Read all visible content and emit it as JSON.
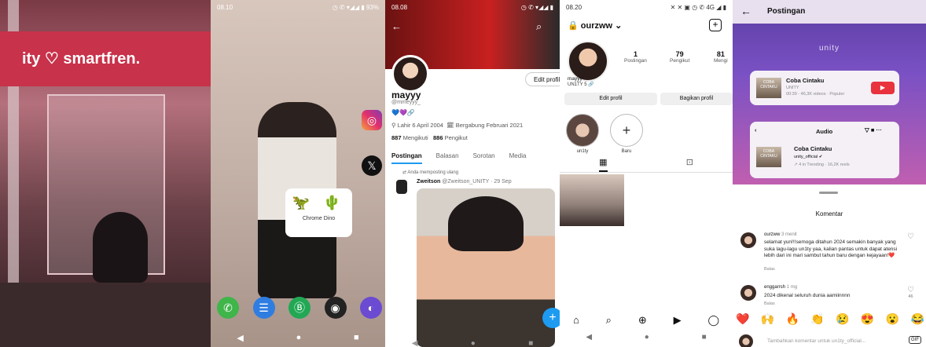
{
  "panel1": {
    "banner_text": "ity ♡ smartfren."
  },
  "panel2": {
    "status_time": "08.10",
    "status_icons": "◷ ✆ ▾◢◢ ▮ 93%",
    "app_dino_label": "Chrome Dino",
    "insta_glyph": "◎",
    "x_glyph": "𝕏",
    "dock_icons": [
      "✆",
      "☰",
      "Ⓑ",
      "◉",
      "◐"
    ],
    "nav": [
      "◀",
      "●",
      "■"
    ]
  },
  "panel3": {
    "status_time": "08.08",
    "status_icons": "◷ ✆ ▾◢◢ ▮",
    "back": "←",
    "search": "⌕",
    "edit_profile": "Edit profil",
    "name": "mayyy",
    "handle": "@mmeyyy_",
    "hearts": "💙💜🔗",
    "birth": "⚲ Lahir 6 April 2004",
    "joined": "🗓 Bergabung Februari 2021",
    "following_count": "887",
    "following_label": "Mengikuti",
    "followers_count": "886",
    "followers_label": "Pengikut",
    "tabs": [
      "Postingan",
      "Balasan",
      "Sorotan",
      "Media"
    ],
    "retweet": "⇄ Anda memposting ulang",
    "post_name": "Zweitson",
    "post_meta": "@Zweitson_UNITY · 29 Sep",
    "fab": "+",
    "nav": [
      "◀",
      "●",
      "■"
    ]
  },
  "panel4": {
    "status_time": "08.20",
    "status_icons": "✕ ✕ ▣  ◷ ✆ 4G ◢ ▮",
    "username": "🔒 ourzww ⌄",
    "plus": "+",
    "stats": [
      {
        "num": "1",
        "label": "Postingan"
      },
      {
        "num": "79",
        "label": "Pengikut"
      },
      {
        "num": "81",
        "label": "Mengi"
      }
    ],
    "display_name": "mayyy",
    "bio": "UN1TY 5 🔗",
    "edit_btn": "Edit profil",
    "share_btn": "Bagikan profil",
    "highlight_labels": [
      "un1ty",
      "Baru"
    ],
    "highlight_new": "+",
    "grid_icon": "▦",
    "tagged_icon": "⊡",
    "bottom_nav": [
      "⌂",
      "⌕",
      "⊕",
      "▶",
      "◯"
    ],
    "sys_nav": [
      "◀",
      "●",
      "■"
    ]
  },
  "panel5": {
    "back": "←",
    "title": "Postingan",
    "brand": "unity",
    "sound1_title": "Coba Cintaku",
    "sound1_artist": "UNITY",
    "sound1_meta": "00:39 · 46,3K videos · Populer",
    "cover_text": "COBA CINTAKU",
    "rec_glyph": "▶",
    "audio_label": "Audio",
    "audio_icons": "▽ ■ ···",
    "audio_back": "‹",
    "sound2_title": "Coba Cintaku",
    "sound2_artist": "unity_official ✔",
    "sound2_trend": "↗ 4 in Trending · 16,2K reels",
    "sheet_title": "Komentar",
    "comments": [
      {
        "user": "ourzww",
        "time": "3 menit",
        "text": "selamat yun!!!semoga ditahun 2024 semakin banyak yang suka lagu-lagu un1ty yaa, kalian pantas untuk dapat atensi lebih dari ini mari sambut tahun baru dengan kejayaan!❤️",
        "reply": "Balas",
        "likes": ""
      },
      {
        "user": "enggarrsh",
        "time": "1 mg",
        "text": "2024 dikenal seluruh dunia aamiinnnn",
        "reply": "Balas",
        "likes": "46"
      }
    ],
    "heart": "♡",
    "emojis": [
      "❤️",
      "🙌",
      "🔥",
      "👏",
      "😢",
      "😍",
      "😮",
      "😂"
    ],
    "input_placeholder": "Tambahkan komentar untuk un1ty_official...",
    "gif": "GIF"
  }
}
